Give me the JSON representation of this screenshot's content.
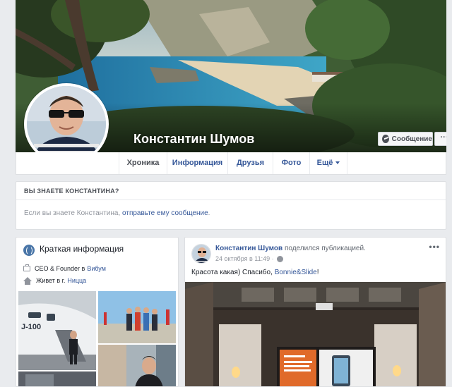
{
  "profile": {
    "name": "Константин Шумов"
  },
  "actions": {
    "message_label": "Сообщение",
    "more_label": "···"
  },
  "tabs": [
    {
      "label": "Хроника"
    },
    {
      "label": "Информация"
    },
    {
      "label": "Друзья"
    },
    {
      "label": "Фото"
    },
    {
      "label": "Ещё"
    }
  ],
  "know_box": {
    "title": "ВЫ ЗНАЕТЕ КОНСТАНТИНА?",
    "text_prefix": "Если вы знаете Константина, ",
    "link": "отправьте ему сообщение",
    "text_suffix": "."
  },
  "intro": {
    "title": "Краткая информация",
    "work_prefix": "CEO & Founder в",
    "work_link": "Вибум",
    "live_prefix": "Живет в г.",
    "live_link": "Ницца"
  },
  "post": {
    "author": "Константин Шумов",
    "action": " поделился публикацией.",
    "time": "24 октября в 11:49 ·",
    "text_prefix": "Красота какая) Спасибо, ",
    "text_link": "Bonnie&Slide",
    "text_suffix": "!",
    "more_label": "•••"
  },
  "colors": {
    "link": "#365899",
    "background": "#e9ebee",
    "card": "#ffffff",
    "border": "#dddfe2"
  }
}
